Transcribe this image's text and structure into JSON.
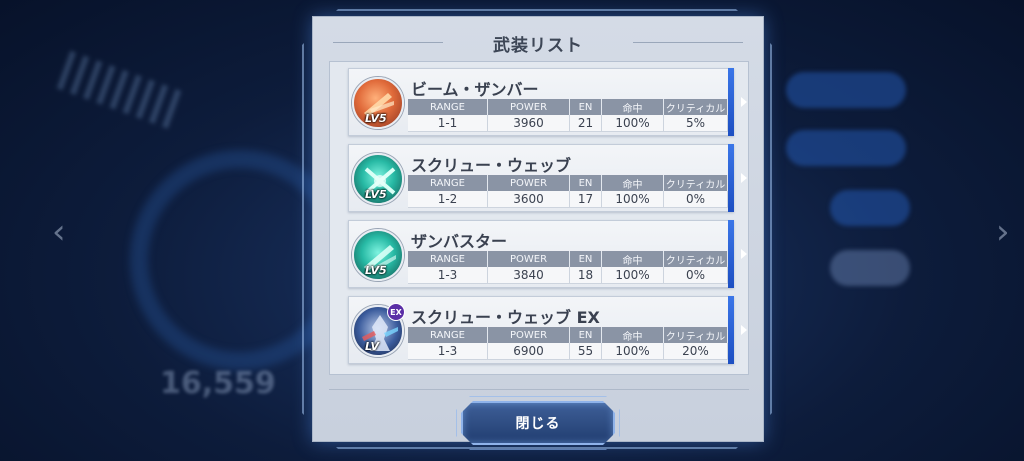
{
  "dialog": {
    "title": "武装リスト",
    "close_label": "閉じる"
  },
  "stat_headers": {
    "range": "RANGE",
    "power": "POWER",
    "en": "EN",
    "hit": "命中",
    "critical": "クリティカル"
  },
  "weapons": [
    {
      "name": "ビーム・ザンバー",
      "level": "LV5",
      "icon": "beam-saber-icon",
      "range": "1-1",
      "power": "3960",
      "en": "21",
      "hit": "100%",
      "critical": "5%"
    },
    {
      "name": "スクリュー・ウェッブ",
      "level": "LV5",
      "icon": "screw-web-icon",
      "range": "1-2",
      "power": "3600",
      "en": "17",
      "hit": "100%",
      "critical": "0%"
    },
    {
      "name": "ザンバスター",
      "level": "LV5",
      "icon": "zanbuster-icon",
      "range": "1-3",
      "power": "3840",
      "en": "18",
      "hit": "100%",
      "critical": "0%"
    },
    {
      "name": "スクリュー・ウェッブ EX",
      "level": "LV",
      "badge": "EX",
      "icon": "mech-portrait-icon",
      "range": "1-3",
      "power": "6900",
      "en": "55",
      "hit": "100%",
      "critical": "20%"
    }
  ],
  "background": {
    "number": "16,559"
  },
  "colors": {
    "accent_blue": "#2f63d6",
    "header_gray": "#8a94a5",
    "panel_bg": "#d4dbe6"
  }
}
